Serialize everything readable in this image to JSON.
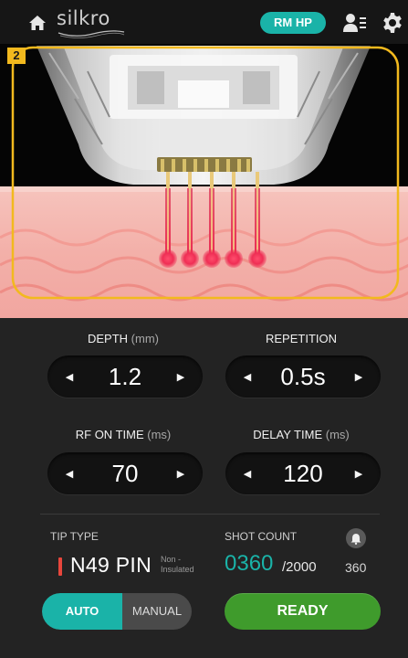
{
  "header": {
    "logo_text": "silkro",
    "mode_badge": "RM HP",
    "icons": [
      "home-icon",
      "user-icon",
      "gear-icon"
    ]
  },
  "illustration": {
    "step_badge": "2"
  },
  "controls": {
    "depth": {
      "label": "DEPTH",
      "unit": "(mm)",
      "value": "1.2"
    },
    "repetition": {
      "label": "REPETITION",
      "unit": "",
      "value": "0.5s"
    },
    "rf_on_time": {
      "label": "RF ON TIME",
      "unit": "(ms)",
      "value": "70"
    },
    "delay_time": {
      "label": "DELAY TIME",
      "unit": "(ms)",
      "value": "120"
    }
  },
  "tip": {
    "label": "TIP TYPE",
    "value": "N49 PIN",
    "note_line1": "Non -",
    "note_line2": "Insulated"
  },
  "shot": {
    "label": "SHOT COUNT",
    "count": "0360",
    "total": "/2000",
    "bell_count": "360"
  },
  "mode": {
    "auto": "AUTO",
    "manual": "MANUAL",
    "selected": "AUTO"
  },
  "ready_label": "READY",
  "colors": {
    "accent": "#1ab3a8",
    "ready": "#3f9b2c",
    "highlight_frame": "#f2b91e",
    "skin": "#f4b6b0",
    "needle_tip": "#e8463c"
  }
}
